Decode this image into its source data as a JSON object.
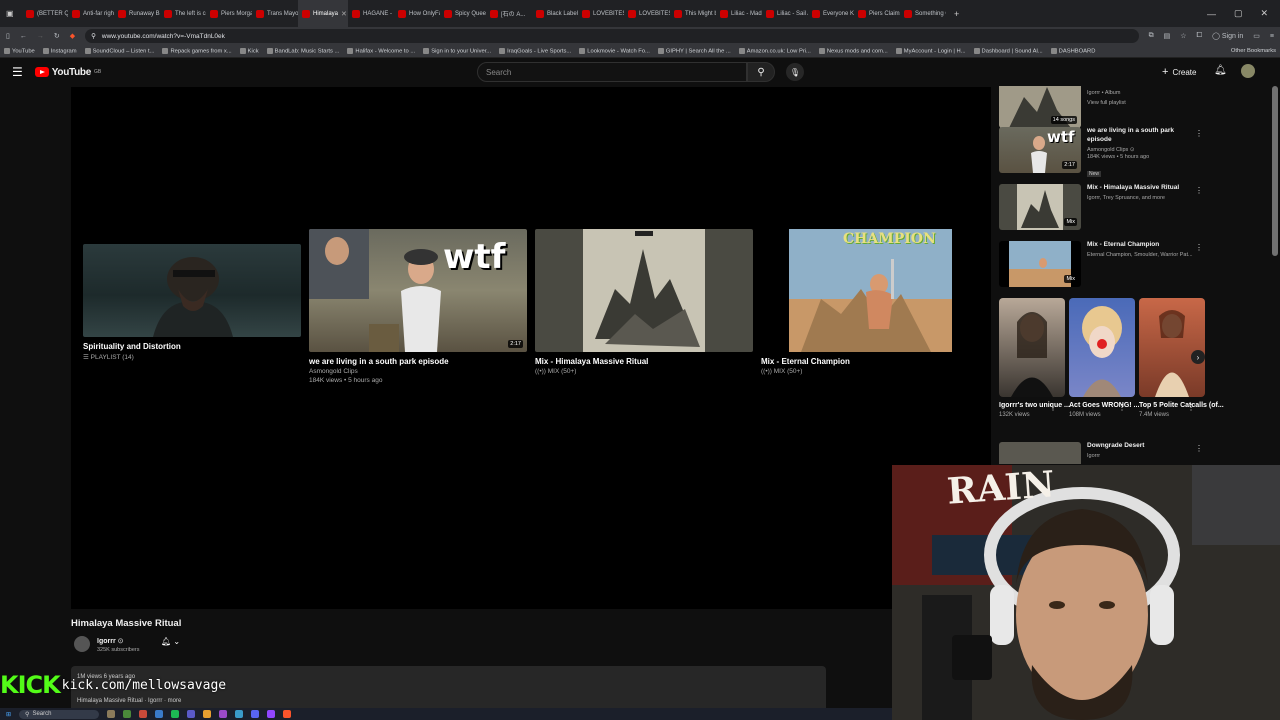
{
  "browser": {
    "tabs": [
      {
        "label": "(BETTER QU"
      },
      {
        "label": "Anti-far righ"
      },
      {
        "label": "Runaway Ba"
      },
      {
        "label": "The left is co"
      },
      {
        "label": "Piers Morga"
      },
      {
        "label": "Trans Mayor"
      },
      {
        "label": "Himalaya",
        "active": true
      },
      {
        "label": "HAGANE - ["
      },
      {
        "label": "How OnlyFa"
      },
      {
        "label": "Spicy Queen"
      },
      {
        "label": "[石の A..."
      },
      {
        "label": "Black Label S"
      },
      {
        "label": "LOVEBITES /"
      },
      {
        "label": "LOVEBITES /"
      },
      {
        "label": "This Might b"
      },
      {
        "label": "Liliac - Madn"
      },
      {
        "label": "Liliac - Sail A"
      },
      {
        "label": "Everyone Kn"
      },
      {
        "label": "Piers Claims"
      },
      {
        "label": "Something C"
      }
    ],
    "url": "www.youtube.com/watch?v=-VmaTdnL0ek",
    "signin": "Sign in",
    "bookmarks": [
      "YouTube",
      "Instagram",
      "SoundCloud – Listen t...",
      "Repack games from x...",
      "Kick",
      "BandLab: Music Starts ...",
      "Halifax - Welcome to ...",
      "Sign in to your Univer...",
      "IraqGoals - Live Sports...",
      "Lookmovie - Watch Fo...",
      "GIPHY | Search All the ...",
      "Amazon.co.uk: Low Pri...",
      "Nexus mods and com...",
      "MyAccount - Login | H...",
      "Dashboard | Sound Al...",
      "DASHBOARD"
    ],
    "other_bookmarks": "Other Bookmarks"
  },
  "youtube": {
    "logo_text": "YouTube",
    "country": "GB",
    "search_placeholder": "Search",
    "create_label": "Create"
  },
  "endcards": [
    {
      "title": "Spirituality and Distortion",
      "meta": "PLAYLIST (14)",
      "duration": ""
    },
    {
      "title": "we are living in a south park episode",
      "meta": "Asmongold Clips",
      "meta2": "184K views • 5 hours ago",
      "duration": "2:17",
      "overlay": "wtf"
    },
    {
      "title": "Mix - Himalaya Massive Ritual",
      "meta": "MIX (50+)",
      "duration": ""
    },
    {
      "title": "Mix - Eternal Champion",
      "meta": "MIX (50+)",
      "duration": "",
      "overlay": "CHAMPION"
    }
  ],
  "video": {
    "title": "Himalaya Massive Ritual",
    "channel": "Igorrr",
    "subscribers": "325K subscribers",
    "desc_line1": "1M views  6 years ago",
    "desc_line2": "Himalaya Massive Ritual · Igorrr · more"
  },
  "sidebar": {
    "playlist": {
      "meta1": "Igorrr • Album",
      "meta2": "View full playlist",
      "count": "14 songs"
    },
    "items": [
      {
        "title": "we are living in a south park episode",
        "channel": "Asmongold Clips",
        "stats": "184K views • 5 hours ago",
        "badge": "New",
        "duration": "2:17",
        "overlay": "wtf"
      },
      {
        "title": "Mix - Himalaya Massive Ritual",
        "channel": "Igorrr, Trey Spruance, and more",
        "duration": "Mix"
      },
      {
        "title": "Mix - Eternal Champion",
        "channel": "Eternal Champion, Smoulder, Warrior Pat...",
        "duration": "Mix"
      }
    ],
    "shorts": [
      {
        "title": "Igorrr's two unique ...",
        "views": "132K views"
      },
      {
        "title": "Act Goes WRONG! ...",
        "views": "108M views"
      },
      {
        "title": "Top 5 Polite Catcalls (of...",
        "views": "7.4M views"
      }
    ],
    "last_item": {
      "title": "Downgrade Desert",
      "channel": "Igorrr"
    }
  },
  "overlay": {
    "kick_logo": "KICK",
    "kick_url": "kick.com/mellowsavage",
    "webcam_sign": "RAIN"
  },
  "taskbar": {
    "search": "Search"
  }
}
